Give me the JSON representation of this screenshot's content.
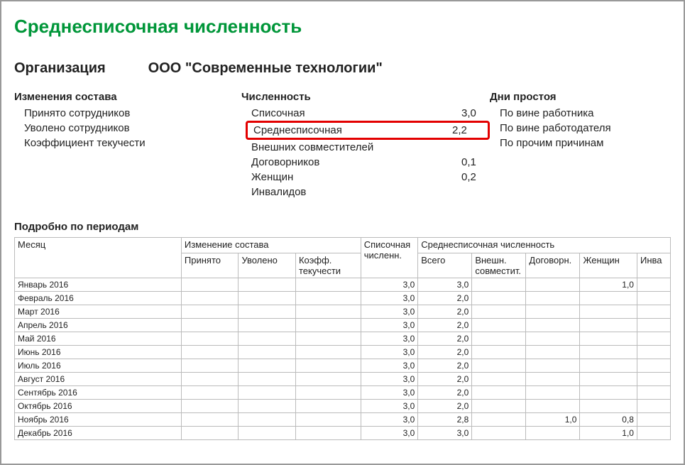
{
  "title": "Среднесписочная численность",
  "orgLabel": "Организация",
  "orgName": "ООО \"Современные технологии\"",
  "sections": {
    "changes": {
      "header": "Изменения состава",
      "rows": [
        {
          "label": "Принято сотрудников",
          "value": ""
        },
        {
          "label": "Уволено сотрудников",
          "value": ""
        },
        {
          "label": "Коэффициент текучести",
          "value": ""
        }
      ]
    },
    "count": {
      "header": "Численность",
      "rows": [
        {
          "label": "Списочная",
          "value": "3,0",
          "highlight": false
        },
        {
          "label": "Среднесписочная",
          "value": "2,2",
          "highlight": true
        },
        {
          "label": "Внешних совместителей",
          "value": "",
          "highlight": false
        },
        {
          "label": "Договорников",
          "value": "0,1",
          "highlight": false
        },
        {
          "label": "Женщин",
          "value": "0,2",
          "highlight": false
        },
        {
          "label": "Инвалидов",
          "value": "",
          "highlight": false
        }
      ]
    },
    "downtime": {
      "header": "Дни простоя",
      "rows": [
        {
          "label": "По вине работника",
          "value": ""
        },
        {
          "label": "По вине работодателя",
          "value": ""
        },
        {
          "label": "По прочим причинам",
          "value": ""
        }
      ]
    }
  },
  "periodsHeader": "Подробно по периодам",
  "table": {
    "headers": {
      "month": "Месяц",
      "changesGroup": "Изменение состава",
      "countGroup": "Среднесписочная численность",
      "spisoch": "Списочная численн.",
      "prinyato": "Принято",
      "uvoleno": "Уволено",
      "koeff": "Коэфф. текучести",
      "vsego": "Всего",
      "vneshn": "Внешн. совместит.",
      "dogovor": "Договорн.",
      "zhenshin": "Женщин",
      "invalid": "Инва"
    },
    "rows": [
      {
        "month": "Январь 2016",
        "spisoch": "3,0",
        "vsego": "3,0",
        "vneshn": "",
        "dogovor": "",
        "zhenshin": "1,0",
        "invalid": ""
      },
      {
        "month": "Февраль 2016",
        "spisoch": "3,0",
        "vsego": "2,0",
        "vneshn": "",
        "dogovor": "",
        "zhenshin": "",
        "invalid": ""
      },
      {
        "month": "Март 2016",
        "spisoch": "3,0",
        "vsego": "2,0",
        "vneshn": "",
        "dogovor": "",
        "zhenshin": "",
        "invalid": ""
      },
      {
        "month": "Апрель 2016",
        "spisoch": "3,0",
        "vsego": "2,0",
        "vneshn": "",
        "dogovor": "",
        "zhenshin": "",
        "invalid": ""
      },
      {
        "month": "Май 2016",
        "spisoch": "3,0",
        "vsego": "2,0",
        "vneshn": "",
        "dogovor": "",
        "zhenshin": "",
        "invalid": ""
      },
      {
        "month": "Июнь 2016",
        "spisoch": "3,0",
        "vsego": "2,0",
        "vneshn": "",
        "dogovor": "",
        "zhenshin": "",
        "invalid": ""
      },
      {
        "month": "Июль 2016",
        "spisoch": "3,0",
        "vsego": "2,0",
        "vneshn": "",
        "dogovor": "",
        "zhenshin": "",
        "invalid": ""
      },
      {
        "month": "Август 2016",
        "spisoch": "3,0",
        "vsego": "2,0",
        "vneshn": "",
        "dogovor": "",
        "zhenshin": "",
        "invalid": ""
      },
      {
        "month": "Сентябрь 2016",
        "spisoch": "3,0",
        "vsego": "2,0",
        "vneshn": "",
        "dogovor": "",
        "zhenshin": "",
        "invalid": ""
      },
      {
        "month": "Октябрь 2016",
        "spisoch": "3,0",
        "vsego": "2,0",
        "vneshn": "",
        "dogovor": "",
        "zhenshin": "",
        "invalid": ""
      },
      {
        "month": "Ноябрь 2016",
        "spisoch": "3,0",
        "vsego": "2,8",
        "vneshn": "",
        "dogovor": "1,0",
        "zhenshin": "0,8",
        "invalid": ""
      },
      {
        "month": "Декабрь 2016",
        "spisoch": "3,0",
        "vsego": "3,0",
        "vneshn": "",
        "dogovor": "",
        "zhenshin": "1,0",
        "invalid": ""
      }
    ]
  }
}
